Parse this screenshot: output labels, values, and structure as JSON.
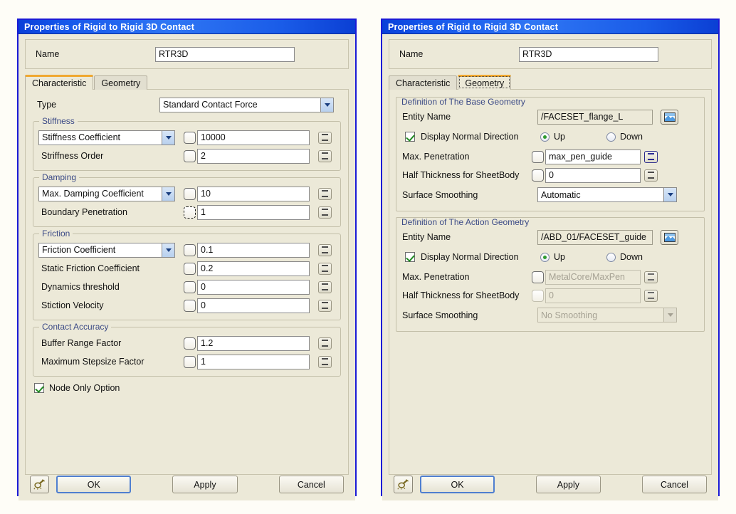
{
  "left": {
    "title": "Properties of Rigid to Rigid 3D Contact",
    "name_label": "Name",
    "name_value": "RTR3D",
    "tabs": [
      {
        "label": "Characteristic",
        "active": true
      },
      {
        "label": "Geometry",
        "active": false
      }
    ],
    "type_label": "Type",
    "type_value": "Standard Contact Force",
    "groups": [
      {
        "legend": "Stiffness",
        "rows": [
          {
            "kind": "select",
            "label": "Stiffness Coefficient",
            "value": "10000"
          },
          {
            "kind": "label",
            "label": "Striffness Order",
            "value": "2"
          }
        ]
      },
      {
        "legend": "Damping",
        "rows": [
          {
            "kind": "select",
            "label": "Max. Damping Coefficient",
            "value": "10"
          },
          {
            "kind": "label",
            "label": "Boundary Penetration",
            "value": "1"
          }
        ]
      },
      {
        "legend": "Friction",
        "rows": [
          {
            "kind": "select",
            "label": "Friction Coefficient",
            "value": "0.1"
          },
          {
            "kind": "label",
            "label": "Static Friction Coefficient",
            "value": "0.2"
          },
          {
            "kind": "label",
            "label": "Dynamics threshold",
            "value": "0"
          },
          {
            "kind": "label",
            "label": "Stiction Velocity",
            "value": "0"
          }
        ]
      },
      {
        "legend": "Contact Accuracy",
        "rows": [
          {
            "kind": "label",
            "label": "Buffer Range Factor",
            "value": "1.2"
          },
          {
            "kind": "label",
            "label": "Maximum Stepsize Factor",
            "value": "1"
          }
        ]
      }
    ],
    "node_only_label": "Node Only Option",
    "buttons": {
      "ok": "OK",
      "apply": "Apply",
      "cancel": "Cancel",
      "tool_icon": "flashlight-icon"
    }
  },
  "right": {
    "title": "Properties of Rigid to Rigid 3D Contact",
    "name_label": "Name",
    "name_value": "RTR3D",
    "tabs": [
      {
        "label": "Characteristic",
        "active": false
      },
      {
        "label": "Geometry",
        "active": true
      }
    ],
    "base": {
      "legend": "Definition of The Base Geometry",
      "entity_label": "Entity Name",
      "entity_value": "/FACESET_flange_L",
      "normal_label": "Display Normal Direction",
      "normal_up": "Up",
      "normal_down": "Down",
      "maxpen_label": "Max. Penetration",
      "maxpen_value": "max_pen_guide",
      "halfthk_label": "Half Thickness for SheetBody",
      "halfthk_value": "0",
      "smoothing_label": "Surface Smoothing",
      "smoothing_value": "Automatic"
    },
    "action": {
      "legend": "Definition of The Action Geometry",
      "entity_label": "Entity Name",
      "entity_value": "/ABD_01/FACESET_guide",
      "normal_label": "Display Normal Direction",
      "normal_up": "Up",
      "normal_down": "Down",
      "maxpen_label": "Max. Penetration",
      "maxpen_value": "MetalCore/MaxPen",
      "halfthk_label": "Half Thickness for SheetBody",
      "halfthk_value": "0",
      "smoothing_label": "Surface Smoothing",
      "smoothing_value": "No Smoothing"
    },
    "buttons": {
      "ok": "OK",
      "apply": "Apply",
      "cancel": "Cancel",
      "tool_icon": "flashlight-icon"
    }
  },
  "colors": {
    "title_blue": "#1455ea",
    "dialog_border": "#1a1ad6",
    "face": "#ece9d8",
    "legend_text": "#3b4a86",
    "active_tab_accent": "#f0a830",
    "check_green": "#1f8a1f",
    "radio_green": "#2e9b2e"
  }
}
